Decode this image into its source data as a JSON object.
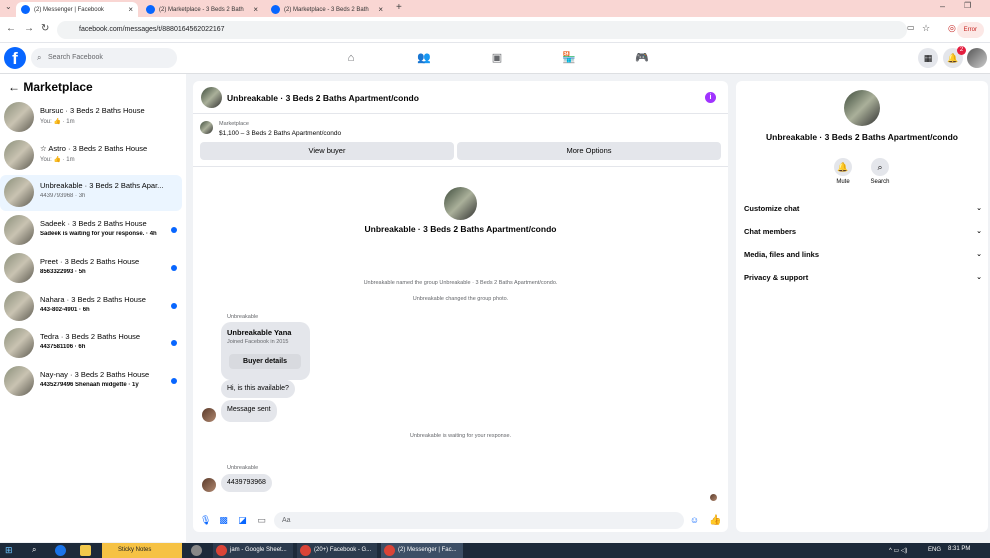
{
  "browser": {
    "tabs": [
      {
        "title": "(2) Messenger | Facebook",
        "active": true
      },
      {
        "title": "(2) Marketplace - 3 Beds 2 Bath",
        "active": false
      },
      {
        "title": "(2) Marketplace - 3 Beds 2 Bath",
        "active": false
      }
    ],
    "new_tab": "+",
    "url": "facebook.com/messages/t/8880164562022167",
    "error_label": "Error"
  },
  "fbnav": {
    "logo": "f",
    "search_placeholder": "Search Facebook",
    "notification_count": "2"
  },
  "sidebar": {
    "title": "Marketplace",
    "conversations": [
      {
        "name": "Bursuc · 3 Beds 2 Baths House",
        "meta": "You: 👍 · 1m",
        "unread": false,
        "active": false
      },
      {
        "name": "☆ Astro · 3 Beds 2 Baths House",
        "meta": "You: 👍 · 1m",
        "unread": false,
        "active": false
      },
      {
        "name": "Unbreakable · 3 Beds 2 Baths Apar...",
        "meta": "4439793968 · 3h",
        "unread": false,
        "active": true
      },
      {
        "name": "Sadeek · 3 Beds 2 Baths House",
        "meta": "Sadeek is waiting for your response. · 4h",
        "unread": true,
        "active": false
      },
      {
        "name": "Preet · 3 Beds 2 Baths House",
        "meta": "8563322993 · 5h",
        "unread": true,
        "active": false
      },
      {
        "name": "Nahara · 3 Beds 2 Baths House",
        "meta": "443-802-4901 · 6h",
        "unread": true,
        "active": false
      },
      {
        "name": "Tedra · 3 Beds 2 Baths House",
        "meta": "4437581106 · 6h",
        "unread": true,
        "active": false
      },
      {
        "name": "Nay-nay · 3 Beds 2 Baths House",
        "meta": "4435279496 Shenaah midgette · 1y",
        "unread": true,
        "active": false
      }
    ]
  },
  "chat": {
    "title": "Unbreakable · 3 Beds 2 Baths Apartment/condo",
    "marketplace_label": "Marketplace",
    "listing": "$1,100 – 3 Beds 2 Baths Apartment/condo",
    "view_buyer": "View buyer",
    "more_options": "More Options",
    "center_title": "Unbreakable · 3 Beds 2 Baths Apartment/condo",
    "system_named": "Unbreakable named the group Unbreakable · 3 Beds 2 Baths Apartment/condo.",
    "system_photo": "Unbreakable changed the group photo.",
    "sender1": "Unbreakable",
    "card_name": "Unbreakable Yana",
    "card_joined": "Joined Facebook in 2015",
    "card_button": "Buyer details",
    "msg_available": "Hi, is this available?",
    "msg_sent": "Message sent",
    "system_waiting": "Unbreakable is waiting for your response.",
    "sender2": "Unbreakable",
    "msg_phone": "4439793968",
    "input_placeholder": "Aa"
  },
  "details": {
    "name": "Unbreakable · 3 Beds 2 Baths Apartment/condo",
    "mute": "Mute",
    "search": "Search",
    "sections": [
      "Customize chat",
      "Chat members",
      "Media, files and links",
      "Privacy & support"
    ]
  },
  "taskbar": {
    "items": [
      "Sticky Notes",
      "jam - Google Sheet...",
      "(20+) Facebook - G...",
      "(2) Messenger | Fac..."
    ],
    "lang": "ENG",
    "time": "8:31 PM"
  },
  "colors": {
    "brand": "#0866ff",
    "unread_dot": "#0866ff",
    "info": "#a033ff",
    "badge": "#e41e3f"
  }
}
